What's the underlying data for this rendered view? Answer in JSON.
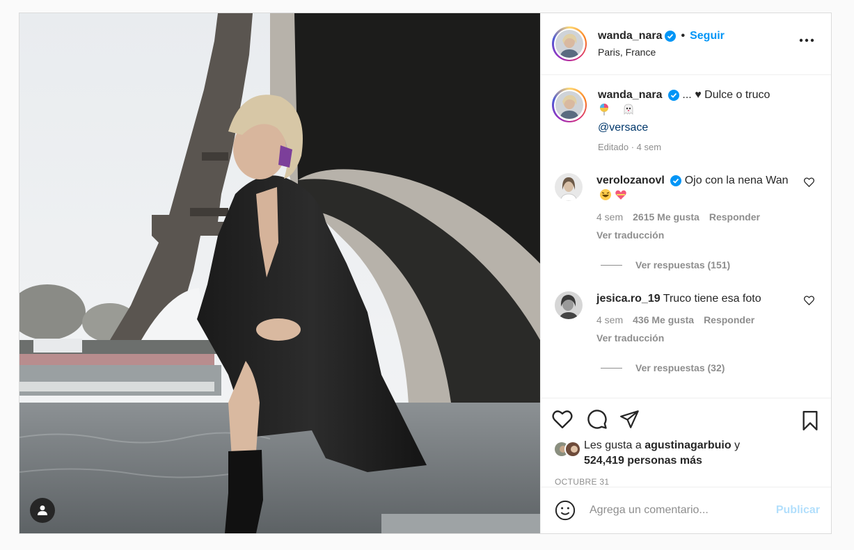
{
  "post": {
    "author": "wanda_nara",
    "follow_label": "Seguir",
    "location": "Paris, France",
    "caption_prefix": "...",
    "caption_text": "Dulce o truco",
    "caption_mention": "@versace",
    "caption_meta": "Editado · 4 sem"
  },
  "comments": [
    {
      "user": "verolozanovl",
      "text": "Ojo con la nena Wan",
      "time": "4 sem",
      "likes": "2615 Me gusta",
      "reply": "Responder",
      "translate": "Ver traducción",
      "view_replies": "Ver respuestas (151)"
    },
    {
      "user": "jesica.ro_19",
      "text": "Truco tiene esa foto",
      "time": "4 sem",
      "likes": "436 Me gusta",
      "reply": "Responder",
      "translate": "Ver traducción",
      "view_replies": "Ver respuestas (32)"
    }
  ],
  "likes": {
    "prefix": "Les gusta a",
    "user": "agustinagarbuio",
    "connector": "y",
    "count": "524,419 personas más"
  },
  "date": "OCTUBRE 31",
  "composer": {
    "placeholder": "Agrega un comentario...",
    "publish_label": "Publicar"
  },
  "icons": [
    "user-tag-icon",
    "verified-badge-icon",
    "more-options-icon",
    "heart-icon",
    "comment-icon",
    "share-icon",
    "bookmark-icon",
    "emoji-icon"
  ],
  "colors": {
    "link": "#0095f6",
    "mention": "#00376b",
    "muted": "#8e8e8e",
    "publish_disabled": "#b2dffc"
  }
}
